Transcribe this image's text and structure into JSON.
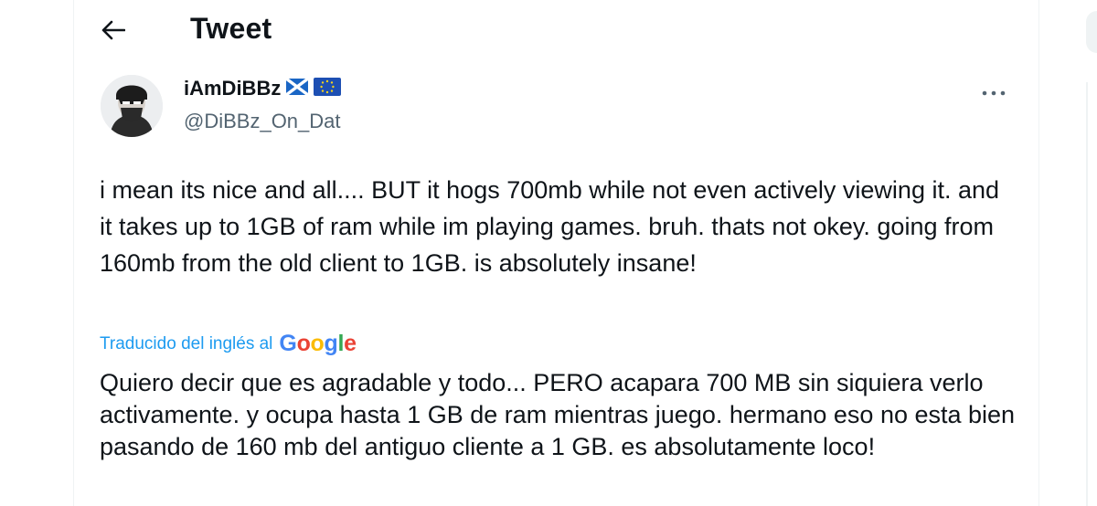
{
  "header": {
    "title": "Tweet"
  },
  "author": {
    "display_name": "iAmDiBBz",
    "handle": "@DiBBz_On_Dat",
    "flags": [
      "scotland-flag-icon",
      "eu-flag-icon"
    ]
  },
  "tweet": {
    "text": "i mean its nice and all.... BUT it hogs 700mb while not even actively viewing it. and it takes up to 1GB of ram while im playing games. bruh. thats not okey. going from 160mb from the old client to 1GB. is absolutely insane!",
    "translation_label": "Traducido del inglés al",
    "translation_provider": "Google",
    "translated_text": "Quiero decir que es agradable y todo... PERO acapara 700 MB sin siquiera verlo activamente. y ocupa hasta 1 GB de ram mientras juego. hermano eso no esta bien pasando de 160 mb del antiguo cliente a 1 GB. es absolutamente loco!"
  },
  "colors": {
    "text": "#0f1419",
    "secondary": "#536471",
    "link": "#1d9bf0",
    "border": "#eff3f4"
  }
}
